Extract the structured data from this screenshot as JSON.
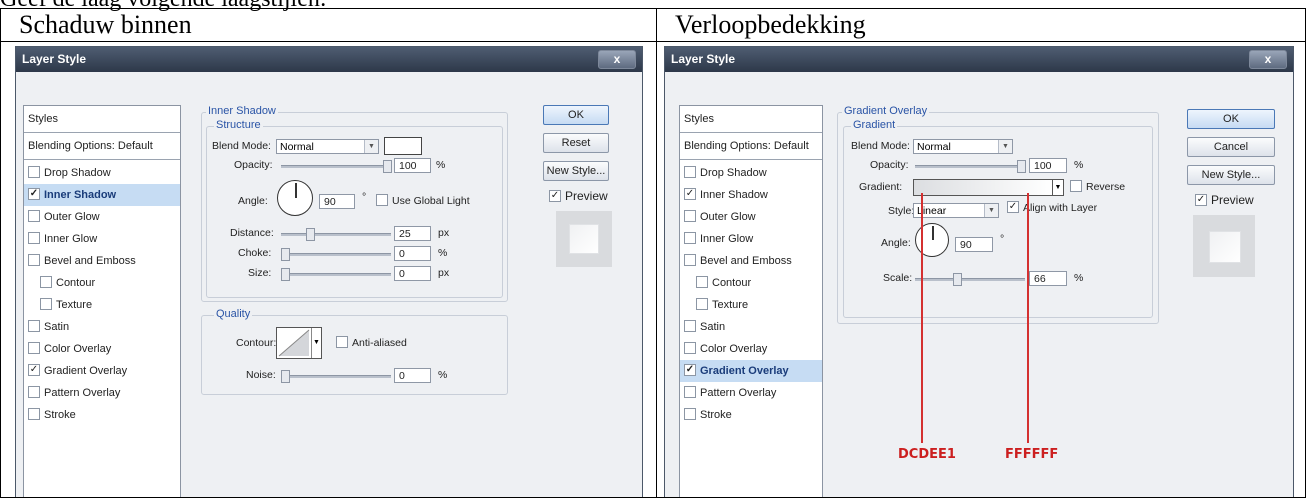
{
  "top_text": "Geef de laag volgende laagstijlen:",
  "columns": [
    {
      "caption": "Schaduw binnen",
      "dialog": {
        "title": "Layer Style",
        "close_glyph": "x",
        "sidebar": {
          "styles": "Styles",
          "blending": "Blending Options: Default",
          "items": [
            {
              "label": "Drop Shadow",
              "checked": false
            },
            {
              "label": "Inner Shadow",
              "checked": true,
              "selected": true
            },
            {
              "label": "Outer Glow",
              "checked": false
            },
            {
              "label": "Inner Glow",
              "checked": false
            },
            {
              "label": "Bevel and Emboss",
              "checked": false
            },
            {
              "label": "Contour",
              "checked": false,
              "indent": true
            },
            {
              "label": "Texture",
              "checked": false,
              "indent": true
            },
            {
              "label": "Satin",
              "checked": false
            },
            {
              "label": "Color Overlay",
              "checked": false
            },
            {
              "label": "Gradient Overlay",
              "checked": true
            },
            {
              "label": "Pattern Overlay",
              "checked": false
            },
            {
              "label": "Stroke",
              "checked": false
            }
          ]
        },
        "section_title": "Inner Shadow",
        "structure_title": "Structure",
        "blend_mode_label": "Blend Mode:",
        "blend_mode_value": "Normal",
        "opacity_label": "Opacity:",
        "opacity_value": "100",
        "pct": "%",
        "angle_label": "Angle:",
        "angle_value": "90",
        "deg": "°",
        "global_light_label": "Use Global Light",
        "distance_label": "Distance:",
        "distance_value": "25",
        "choke_label": "Choke:",
        "choke_value": "0",
        "size_label": "Size:",
        "size_value": "0",
        "px": "px",
        "quality_title": "Quality",
        "contour_label": "Contour:",
        "anti_aliased_label": "Anti-aliased",
        "noise_label": "Noise:",
        "noise_value": "0",
        "buttons": {
          "ok": "OK",
          "second": "Reset",
          "new_style": "New Style...",
          "preview": "Preview"
        },
        "preview_checked": true
      }
    },
    {
      "caption": "Verloopbedekking",
      "dialog": {
        "title": "Layer Style",
        "close_glyph": "x",
        "sidebar": {
          "styles": "Styles",
          "blending": "Blending Options: Default",
          "items": [
            {
              "label": "Drop Shadow",
              "checked": false
            },
            {
              "label": "Inner Shadow",
              "checked": true
            },
            {
              "label": "Outer Glow",
              "checked": false
            },
            {
              "label": "Inner Glow",
              "checked": false
            },
            {
              "label": "Bevel and Emboss",
              "checked": false
            },
            {
              "label": "Contour",
              "checked": false,
              "indent": true
            },
            {
              "label": "Texture",
              "checked": false,
              "indent": true
            },
            {
              "label": "Satin",
              "checked": false
            },
            {
              "label": "Color Overlay",
              "checked": false
            },
            {
              "label": "Gradient Overlay",
              "checked": true,
              "selected": true
            },
            {
              "label": "Pattern Overlay",
              "checked": false
            },
            {
              "label": "Stroke",
              "checked": false
            }
          ]
        },
        "section_title": "Gradient Overlay",
        "gradient_group_title": "Gradient",
        "blend_mode_label": "Blend Mode:",
        "blend_mode_value": "Normal",
        "opacity_label": "Opacity:",
        "opacity_value": "100",
        "pct": "%",
        "gradient_label": "Gradient:",
        "reverse_label": "Reverse",
        "style_label": "Style:",
        "style_value": "Linear",
        "align_label": "Align with Layer",
        "angle_label": "Angle:",
        "angle_value": "90",
        "deg": "°",
        "scale_label": "Scale:",
        "scale_value": "66",
        "buttons": {
          "ok": "OK",
          "second": "Cancel",
          "new_style": "New Style...",
          "preview": "Preview"
        },
        "preview_checked": true,
        "annotations": {
          "left": "DCDEE1",
          "right": "FFFFFF"
        },
        "colors": {
          "gradient_start": "#DCDEE1",
          "gradient_end": "#FFFFFF"
        }
      }
    }
  ]
}
